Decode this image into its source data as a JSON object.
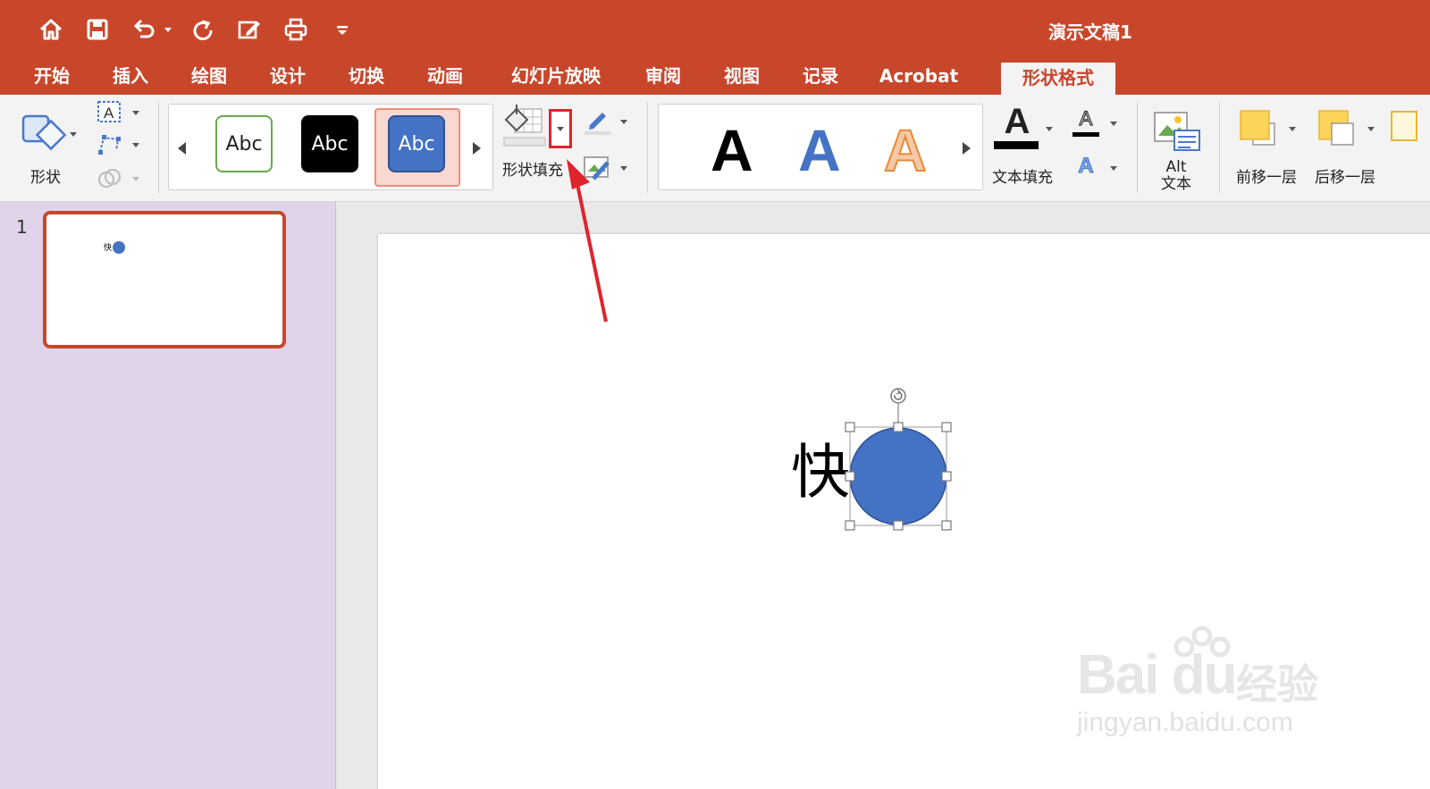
{
  "title_bar": {
    "doc_title": "演示文稿1"
  },
  "tabs": [
    {
      "label": "开始"
    },
    {
      "label": "插入"
    },
    {
      "label": "绘图"
    },
    {
      "label": "设计"
    },
    {
      "label": "切换"
    },
    {
      "label": "动画"
    },
    {
      "label": "幻灯片放映"
    },
    {
      "label": "审阅"
    },
    {
      "label": "视图"
    },
    {
      "label": "记录"
    },
    {
      "label": "Acrobat"
    },
    {
      "label": "形状格式"
    }
  ],
  "ribbon": {
    "shapes_label": "形状",
    "styles": [
      {
        "label": "Abc"
      },
      {
        "label": "Abc"
      },
      {
        "label": "Abc"
      }
    ],
    "shape_fill_label": "形状填充",
    "wordart_letter": "A",
    "text_fill_label": "文本填充",
    "text_outline_letter": "A",
    "text_effect_letter": "A",
    "alt_text_line1": "Alt",
    "alt_text_line2": "文本",
    "bring_forward_label": "前移一层",
    "send_backward_label": "后移一层"
  },
  "thumbnails": {
    "slide_number": "1",
    "thumb_char": "快"
  },
  "slide": {
    "text_char": "快"
  },
  "watermark": {
    "brand": "Bai du",
    "cn": "经验",
    "url": "jingyan.baidu.com"
  },
  "colors": {
    "accent": "#c8472b",
    "shape_fill": "#4472c4",
    "annotation_red": "#e0232e",
    "panel_bg": "#e1d3ea"
  }
}
